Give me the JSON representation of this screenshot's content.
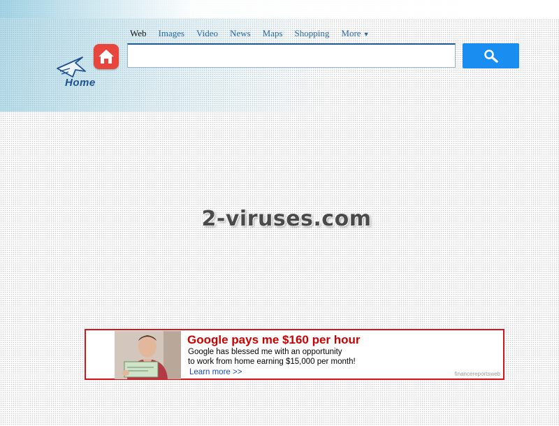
{
  "nav": {
    "items": [
      {
        "label": "Web",
        "active": true
      },
      {
        "label": "Images",
        "active": false
      },
      {
        "label": "Video",
        "active": false
      },
      {
        "label": "News",
        "active": false
      },
      {
        "label": "Maps",
        "active": false
      },
      {
        "label": "Shopping",
        "active": false
      }
    ],
    "more_label": "More"
  },
  "logo": {
    "text": "Home",
    "icon": "arrow-cursor-icon"
  },
  "home_button": {
    "icon": "house-icon",
    "color": "#e8453c"
  },
  "search": {
    "value": "",
    "button_icon": "search-icon",
    "button_color": "#1a8ef0"
  },
  "watermark": "2-viruses.com",
  "ad": {
    "title": "Google pays me $160 per hour",
    "body_line1": "Google has blessed me with an opportunity",
    "body_line2": "to work from home earning $15,000 per month!",
    "link": "Learn more >>",
    "source": "financereportsweb",
    "border_color": "#d5141a",
    "title_color": "#cc0000"
  }
}
